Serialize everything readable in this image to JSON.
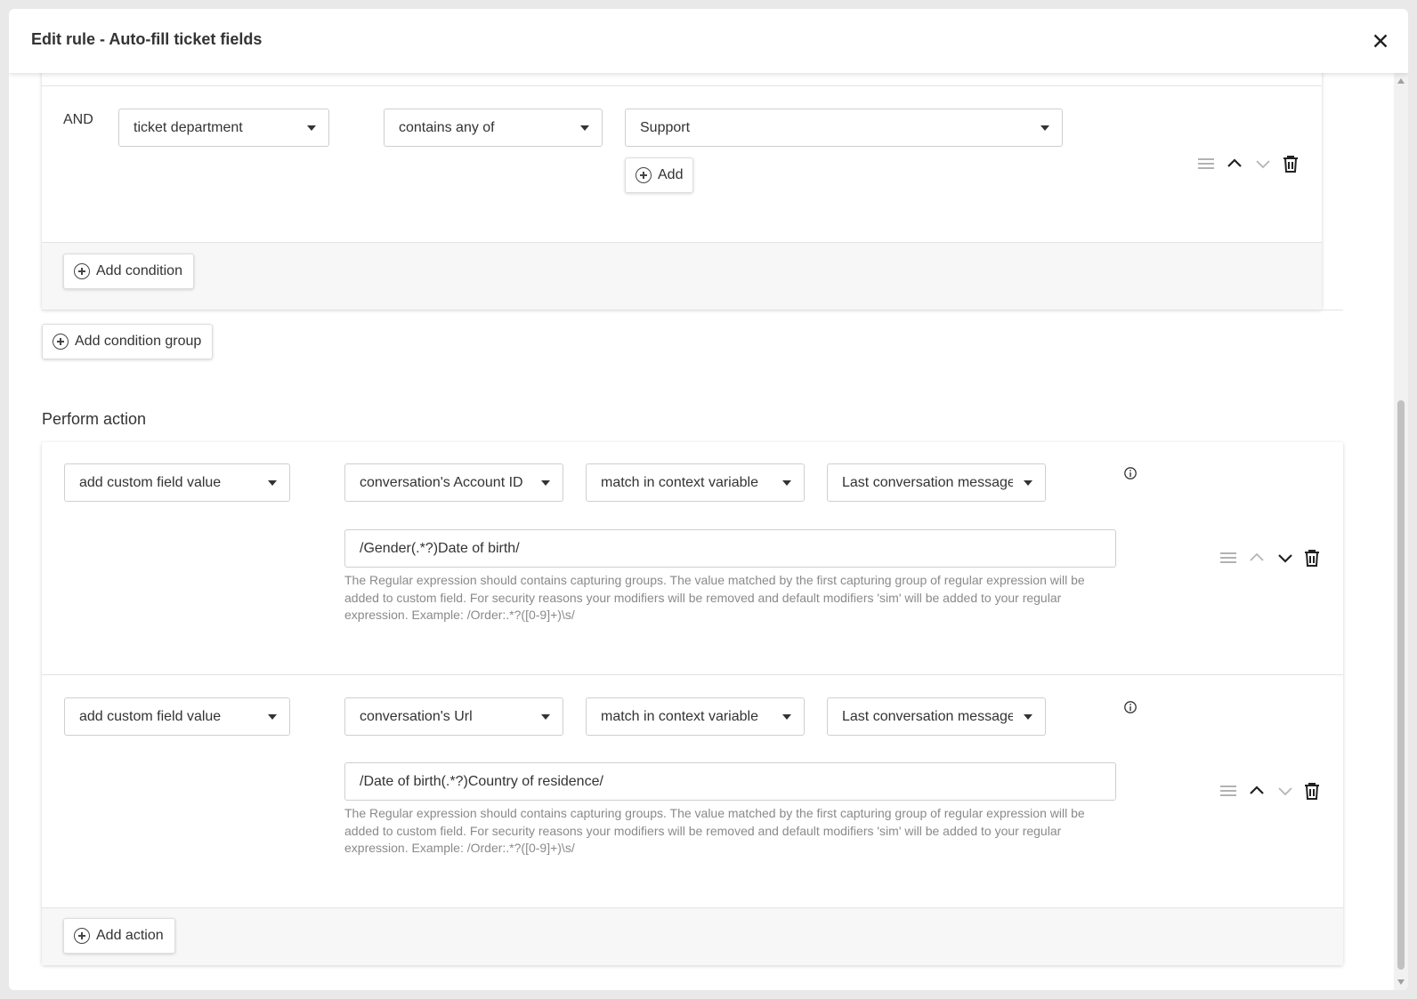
{
  "modal": {
    "title": "Edit rule - Auto-fill ticket fields"
  },
  "conditions": {
    "row": {
      "operator": "AND",
      "field": "ticket department",
      "comparison": "contains any of",
      "value": "Support",
      "add_label": "Add"
    },
    "add_condition_label": "Add condition",
    "add_condition_group_label": "Add condition group"
  },
  "actions": {
    "section_title": "Perform action",
    "items": [
      {
        "action": "add custom field value",
        "field": "conversation's Account ID",
        "method": "match in context variable",
        "source": "Last conversation message",
        "regex": "/Gender(.*?)Date of birth/",
        "help": "The Regular expression should contains capturing groups. The value matched by the first capturing group of regular expression will be added to custom field. For security reasons your modifiers will be removed and default modifiers 'sim' will be added to your regular expression. Example: /Order:.*?([0-9]+)\\s/"
      },
      {
        "action": "add custom field value",
        "field": "conversation's Url",
        "method": "match in context variable",
        "source": "Last conversation message",
        "regex": "/Date of birth(.*?)Country of residence/",
        "help": "The Regular expression should contains capturing groups. The value matched by the first capturing group of regular expression will be added to custom field. For security reasons your modifiers will be removed and default modifiers 'sim' will be added to your regular expression. Example: /Order:.*?([0-9]+)\\s/"
      }
    ],
    "add_action_label": "Add action"
  },
  "icons": {
    "close": "close-icon",
    "drag": "drag-handle-icon",
    "up": "chevron-up-icon",
    "down": "chevron-down-icon",
    "delete": "trash-icon",
    "info": "info-icon",
    "add": "plus-circle-icon"
  },
  "colors": {
    "text": "#333333",
    "help_text": "#8a8a8a",
    "border": "#cfcfcf",
    "disabled_icon": "#b5b5b5"
  }
}
